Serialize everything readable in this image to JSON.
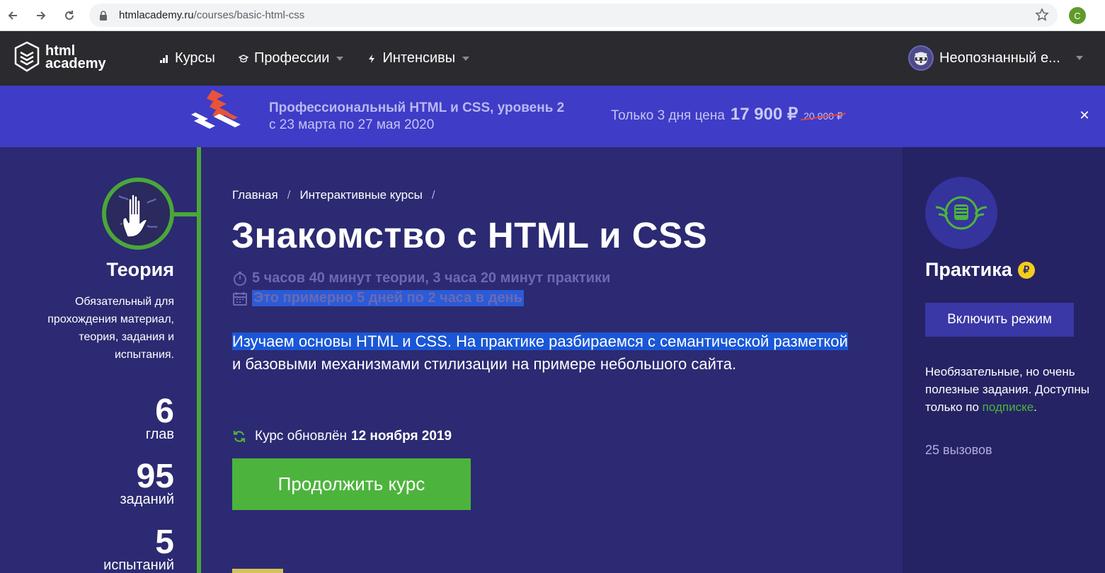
{
  "browser": {
    "url_domain": "htmlacademy.ru",
    "url_path": "/courses/basic-html-css",
    "profile_initial": "C"
  },
  "header": {
    "logo_line1": "html",
    "logo_line2": "academy",
    "nav": [
      {
        "label": "Курсы",
        "icon": "bar-chart-icon"
      },
      {
        "label": "Профессии",
        "icon": "graduation-cap-icon",
        "has_dropdown": true
      },
      {
        "label": "Интенсивы",
        "icon": "lightning-icon",
        "has_dropdown": true
      }
    ],
    "user_name": "Неопознанный е..."
  },
  "promo": {
    "title": "Профессиональный HTML и CSS, уровень 2",
    "dates": "с 23 марта по 27 мая 2020",
    "price_prefix": "Только 3 дня цена",
    "price_new": "17 900 ₽",
    "price_old": "20 900 ₽",
    "close": "✕"
  },
  "theory": {
    "title": "Теория",
    "description": "Обязательный для прохождения материал, теория, задания и испытания.",
    "stats": [
      {
        "num": "6",
        "label": "глав"
      },
      {
        "num": "95",
        "label": "заданий"
      },
      {
        "num": "5",
        "label": "испытаний"
      }
    ]
  },
  "main": {
    "breadcrumb": [
      "Главная",
      "Интерактивные курсы"
    ],
    "title": "Знакомство с HTML и CSS",
    "duration": "5 часов 40 минут теории, 3 часа 20 минут практики",
    "schedule": "Это примерно 5 дней по 2 часа в день",
    "description_line1": "Изучаем основы HTML и CSS. На практике разбираемся с семантической разметкой",
    "description_line2": "и базовыми механизмами стилизации на примере небольшого сайта.",
    "updated_prefix": "Курс обновлён",
    "updated_date": "12 ноября 2019",
    "continue_button": "Продолжить курс"
  },
  "practice": {
    "title": "Практика",
    "coin": "₽",
    "enable_button": "Включить режим",
    "desc_before_link": "Необязательные, но очень полезные задания. Доступны только по ",
    "desc_link": "подписке",
    "desc_after_link": ".",
    "challenges": "25 вызовов"
  },
  "colors": {
    "header_bg": "#2b2a2f",
    "promo_bg": "#3f3cc7",
    "page_bg": "#2c2a72",
    "accent_green": "#4cb43c",
    "coin_yellow": "#f3cd1a"
  }
}
